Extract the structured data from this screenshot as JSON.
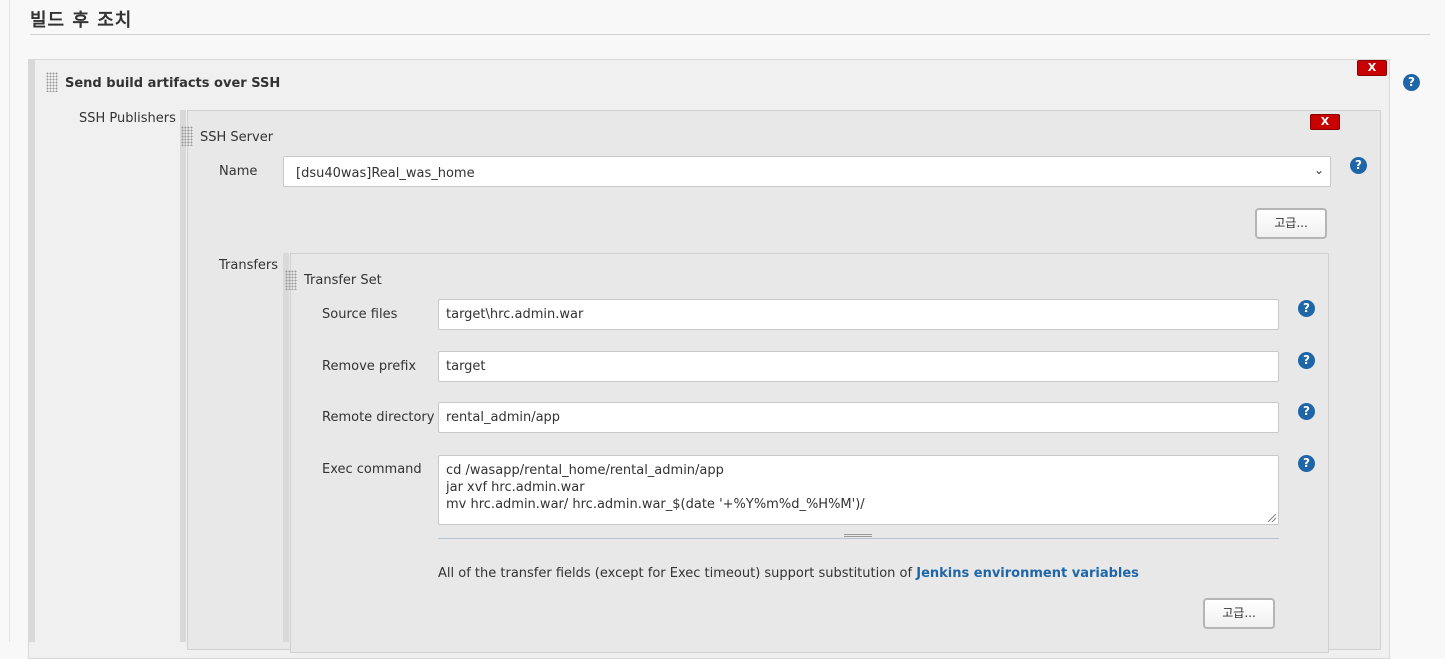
{
  "section": {
    "title": "빌드 후 조치"
  },
  "publisher": {
    "title": "Send build artifacts over SSH",
    "delete_label": "X",
    "help_icon": "?"
  },
  "ssh_publishers": {
    "label": "SSH Publishers",
    "server": {
      "title": "SSH Server",
      "delete_label": "X",
      "name_label": "Name",
      "name_value": "[dsu40was]Real_was_home",
      "advanced_label": "고급...",
      "help_icon": "?"
    }
  },
  "transfers": {
    "label": "Transfers",
    "set_title": "Transfer Set",
    "source_files_label": "Source files",
    "source_files_value": "target\\hrc.admin.war",
    "remove_prefix_label": "Remove prefix",
    "remove_prefix_value": "target",
    "remote_directory_label": "Remote directory",
    "remote_directory_value": "rental_admin/app",
    "exec_command_label": "Exec command",
    "exec_command_lines": [
      "cd /wasapp/rental_home/rental_admin/app",
      "jar xvf hrc.admin.war",
      "mv hrc.admin.war/ hrc.admin.war_$(date '+%Y%m%d_%H%M')/"
    ],
    "note_text": "All of the transfer fields (except for Exec timeout) support substitution of ",
    "note_link": "Jenkins environment variables",
    "advanced_label": "고급..."
  },
  "colors": {
    "delete_button": "#c80000",
    "help_icon": "#1f66a8",
    "link": "#1f66a8"
  }
}
